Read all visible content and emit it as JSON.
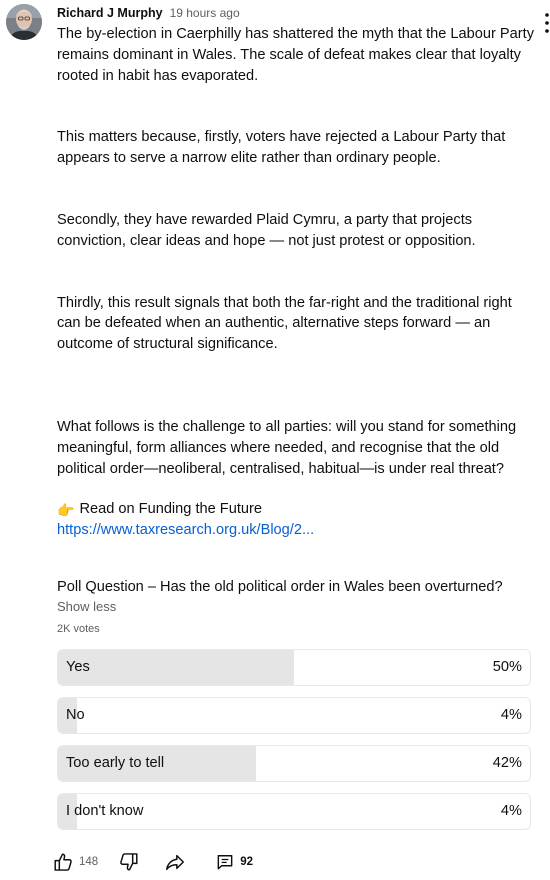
{
  "comment": {
    "author": "Richard J Murphy",
    "time": "19 hours ago",
    "paragraphs": [
      "The by-election in Caerphilly has shattered the myth that the Labour Party remains dominant in Wales. The scale of defeat makes clear that loyalty rooted in habit has evaporated.",
      "This matters because, firstly, voters have rejected a Labour Party that appears to serve a narrow elite rather than ordinary people.",
      "Secondly, they have rewarded Plaid Cymru, a party that projects conviction, clear ideas and hope — not just protest or opposition.",
      "Thirdly, this result signals that both the far-right and the traditional right can be defeated when an authentic, alternative steps forward — an outcome of structural significance.",
      "What follows is the challenge to all parties: will you stand for something meaningful, form alliances where needed, and recognise that the old political order—neoliberal, centralised, habitual—is under real threat?"
    ],
    "read_on": "Read on Funding the Future",
    "read_on_icon": "pointing-hand-icon",
    "link_text": "https://www.taxresearch.org.uk/Blog/2..."
  },
  "poll": {
    "question": "Poll Question – Has the old political order in Wales been overturned?",
    "show_less": "Show less",
    "votes": "2K votes",
    "options": [
      {
        "label": "Yes",
        "percent_text": "50%",
        "percent": 50
      },
      {
        "label": "No",
        "percent_text": "4%",
        "percent": 4
      },
      {
        "label": "Too early to tell",
        "percent_text": "42%",
        "percent": 42
      },
      {
        "label": "I don't know",
        "percent_text": "4%",
        "percent": 4
      }
    ]
  },
  "actions": {
    "like_count": "148",
    "reply_count": "92",
    "icons": [
      "thumbs-up-icon",
      "thumbs-down-icon",
      "share-icon",
      "comment-icon"
    ]
  },
  "colors": {
    "link": "#065fd4",
    "poll_fill": "#e5e5e5",
    "secondary_text": "#606060"
  }
}
